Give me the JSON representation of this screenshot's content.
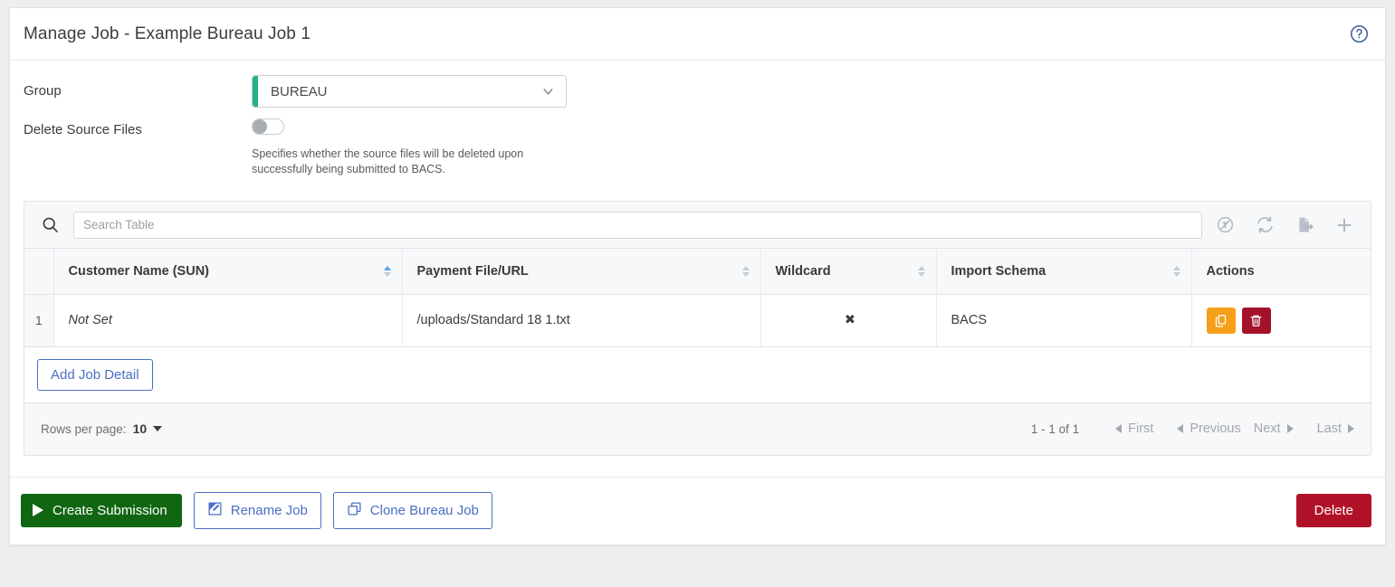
{
  "header": {
    "title": "Manage Job - Example Bureau Job 1",
    "help_icon": "help-circle-icon"
  },
  "form": {
    "group": {
      "label": "Group",
      "value": "BUREAU",
      "accent_color": "#23b18c",
      "caret_icon": "chevron-down-icon"
    },
    "delete_source_files": {
      "label": "Delete Source Files",
      "state": "off",
      "hint": "Specifies whether the source files will be deleted upon successfully being submitted to BACS."
    }
  },
  "table": {
    "toolbar": {
      "search_icon": "search-icon",
      "search_value": "",
      "search_placeholder": "Search Table",
      "icons": [
        {
          "name": "clear-filter-icon",
          "title": "Clear Filter"
        },
        {
          "name": "refresh-icon",
          "title": "Refresh"
        },
        {
          "name": "export-icon",
          "title": "Export"
        },
        {
          "name": "add-icon",
          "title": "Add"
        }
      ]
    },
    "columns": [
      {
        "label": "Customer Name (SUN)",
        "sortable": true,
        "sort": "asc"
      },
      {
        "label": "Payment File/URL",
        "sortable": true,
        "sort": "none"
      },
      {
        "label": "Wildcard",
        "sortable": true,
        "sort": "none"
      },
      {
        "label": "Import Schema",
        "sortable": true,
        "sort": "none"
      },
      {
        "label": "Actions",
        "sortable": false,
        "sort": "none"
      }
    ],
    "rows": [
      {
        "index": "1",
        "customer_name": "Not Set",
        "payment_file": "/uploads/Standard 18 1.txt",
        "wildcard": "✖",
        "import_schema": "BACS",
        "actions": [
          {
            "name": "copy-row-button",
            "icon": "copy-icon",
            "color": "#f6a01a"
          },
          {
            "name": "delete-row-button",
            "icon": "trash-icon",
            "color": "#a3122a"
          }
        ]
      }
    ],
    "add_row_button": "Add Job Detail",
    "footer": {
      "rows_per_page_label": "Rows per page:",
      "rows_per_page_value": "10",
      "range": "1 - 1 of 1",
      "first": "First",
      "previous": "Previous",
      "next": "Next",
      "last": "Last"
    }
  },
  "footer_actions": {
    "create_submission": "Create Submission",
    "rename_job": "Rename Job",
    "clone_bureau_job": "Clone Bureau Job",
    "delete": "Delete"
  }
}
